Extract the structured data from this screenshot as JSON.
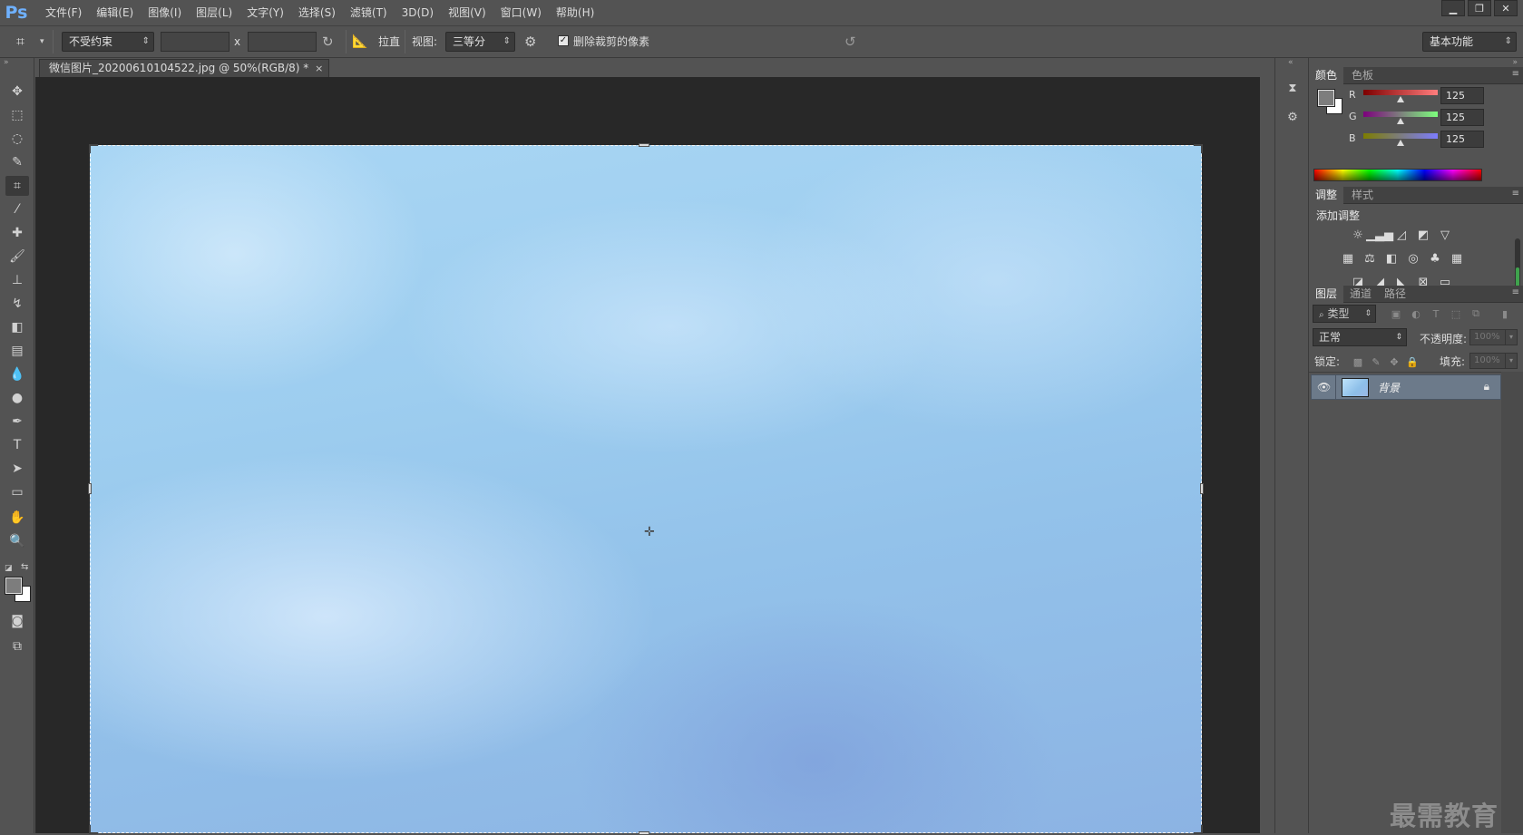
{
  "app": {
    "logo": "Ps"
  },
  "menu": {
    "items": [
      "文件(F)",
      "编辑(E)",
      "图像(I)",
      "图层(L)",
      "文字(Y)",
      "选择(S)",
      "滤镜(T)",
      "3D(D)",
      "视图(V)",
      "窗口(W)",
      "帮助(H)"
    ]
  },
  "window_controls": {
    "minimize": "▁",
    "restore": "❐",
    "close": "✕"
  },
  "options_bar": {
    "ratio_select": "不受约束",
    "width_value": "",
    "times_label": "x",
    "height_value": "",
    "straighten_label": "拉直",
    "view_label": "视图:",
    "view_select": "三等分",
    "delete_cropped_label": "删除裁剪的像素",
    "delete_cropped_checked": true,
    "workspace_select": "基本功能"
  },
  "document": {
    "tab_title": "微信图片_20200610104522.jpg @ 50%(RGB/8) *",
    "close": "×"
  },
  "color_panel": {
    "tabs": [
      "颜色",
      "色板"
    ],
    "channels": [
      {
        "label": "R",
        "value": "125",
        "gradient": [
          "#7d0000",
          "#ff7d7d"
        ]
      },
      {
        "label": "G",
        "value": "125",
        "gradient": [
          "#7d007d",
          "#7dff7d"
        ]
      },
      {
        "label": "B",
        "value": "125",
        "gradient": [
          "#7d7d00",
          "#7d7dff"
        ]
      }
    ],
    "foreground": "#7d7d7d",
    "background": "#ffffff"
  },
  "adjustments_panel": {
    "tabs": [
      "调整",
      "样式"
    ],
    "title": "添加调整"
  },
  "layers_panel": {
    "tabs": [
      "图层",
      "通道",
      "路径"
    ],
    "filter_select": "类型",
    "blend_mode": "正常",
    "opacity_label": "不透明度:",
    "opacity_value": "100%",
    "lock_label": "锁定:",
    "fill_label": "填充:",
    "fill_value": "100%",
    "layers": [
      {
        "name": "背景",
        "visible": true,
        "locked": true
      }
    ]
  },
  "watermark": "最需教育"
}
